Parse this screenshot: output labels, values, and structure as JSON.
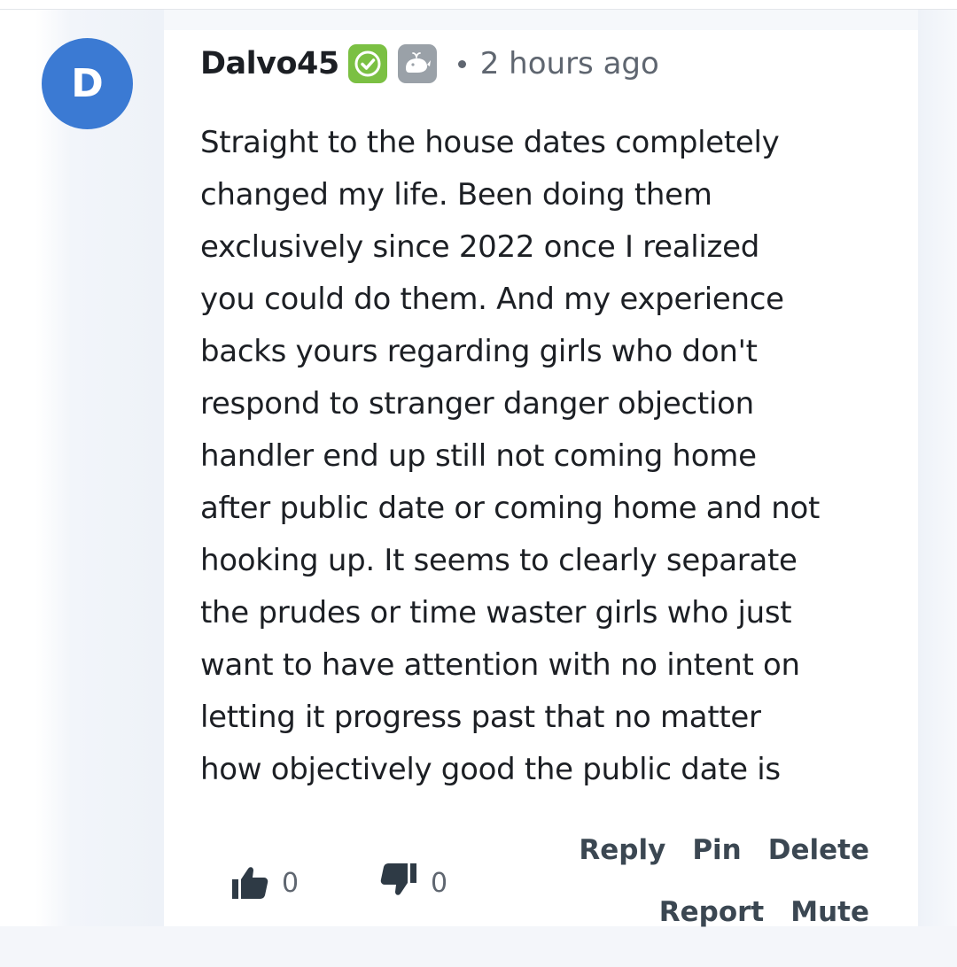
{
  "comment": {
    "avatar_letter": "D",
    "username": "Dalvo45",
    "separator": "•",
    "timestamp": "2 hours ago",
    "body_lines": [
      "Straight to the house dates completely",
      "changed my life. Been doing them",
      "exclusively since 2022 once I realized",
      "you could do them. And my experience",
      "backs yours regarding girls who don't",
      "respond to stranger danger objection",
      "handler end up still not coming home",
      "after public date or coming home and not",
      "hooking up. It seems to clearly separate",
      "the prudes or time waster girls who just",
      "want to have attention with no intent on",
      "letting it progress past that no matter",
      "how objectively good the public date is"
    ],
    "upvotes": "0",
    "downvotes": "0",
    "actions": {
      "reply": "Reply",
      "pin": "Pin",
      "delete": "Delete",
      "report": "Report",
      "mute": "Mute"
    }
  },
  "icons": {
    "verified": "check-badge-icon",
    "gray_badge": "whale-badge-icon",
    "upvote": "thumbs-up-icon",
    "downvote": "thumbs-down-icon"
  },
  "colors": {
    "avatar": "#3b7ad3",
    "verified_badge": "#7bc043",
    "gray_badge": "#9aa1a8",
    "text": "#1c1f24",
    "muted": "#5f6670",
    "action": "#3b4752"
  }
}
